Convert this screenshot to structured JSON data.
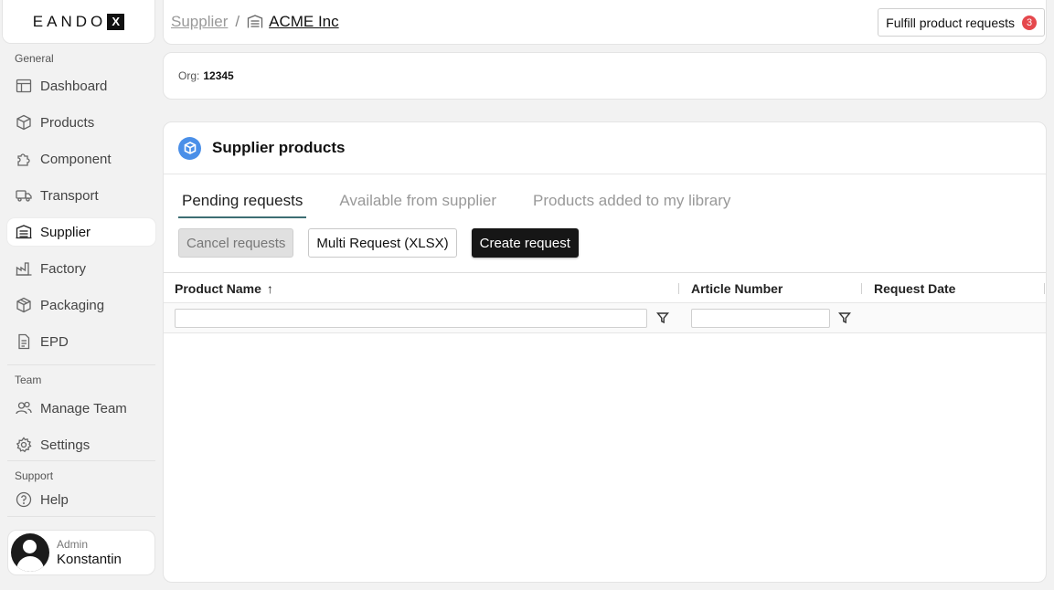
{
  "brand": {
    "name": "EANDO",
    "mark": "X"
  },
  "sidebar": {
    "general_label": "General",
    "team_label": "Team",
    "support_label": "Support",
    "items": [
      {
        "label": "Dashboard",
        "icon": "dashboard-icon"
      },
      {
        "label": "Products",
        "icon": "cube-icon"
      },
      {
        "label": "Component",
        "icon": "puzzle-icon"
      },
      {
        "label": "Transport",
        "icon": "truck-icon"
      },
      {
        "label": "Supplier",
        "icon": "warehouse-icon",
        "active": true
      },
      {
        "label": "Factory",
        "icon": "factory-icon"
      },
      {
        "label": "Packaging",
        "icon": "package-icon"
      },
      {
        "label": "EPD",
        "icon": "document-icon"
      }
    ],
    "team_items": [
      {
        "label": "Manage Team",
        "icon": "users-icon"
      },
      {
        "label": "Settings",
        "icon": "gear-icon"
      }
    ],
    "support_items": [
      {
        "label": "Help",
        "icon": "help-icon"
      }
    ],
    "user": {
      "role": "Admin",
      "name": "Konstantin"
    }
  },
  "header": {
    "breadcrumb_root": "Supplier",
    "breadcrumb_sep": "/",
    "breadcrumb_current": "ACME Inc",
    "fulfill_label": "Fulfill product requests",
    "fulfill_count": "3"
  },
  "org": {
    "label": "Org:",
    "value": "12345"
  },
  "main": {
    "title": "Supplier products",
    "tabs": [
      "Pending requests",
      "Available from supplier",
      "Products added to my library"
    ],
    "active_tab": 0,
    "buttons": {
      "cancel": "Cancel requests",
      "multi": "Multi Request (XLSX)",
      "create": "Create request"
    },
    "columns": [
      "Product Name",
      "Article Number",
      "Request Date"
    ],
    "sort_indicator": "↑"
  },
  "colors": {
    "accent": "#4a8fe8",
    "badge": "#e5484d",
    "tab_underline": "#3c6e73"
  }
}
